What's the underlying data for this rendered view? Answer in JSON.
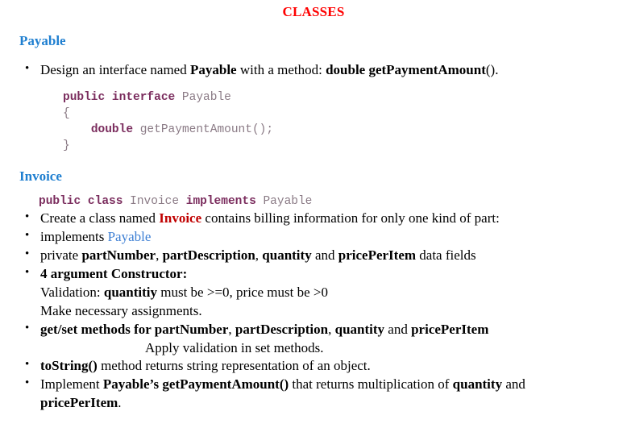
{
  "document": {
    "title": "CLASSES",
    "title_color": "#ff0000",
    "heading_color": "#1f7fd0",
    "link_color": "#3d7fd4",
    "accent_red": "#c00000",
    "code_keyword_color": "#7b2d5e",
    "code_identifier_color": "#8a7a85",
    "background_color": "#ffffff"
  },
  "payable_section": {
    "heading": "Payable",
    "bullet": {
      "text_1": "Design an interface named ",
      "bold_1": "Payable",
      "text_2": " with a method: ",
      "bold_2": "double getPaymentAmount",
      "text_3": "()."
    },
    "code": {
      "line1_kw1": "public interface",
      "line1_name": " Payable",
      "line2": "{",
      "line3_kw": "double",
      "line3_rest": " getPaymentAmount();",
      "line4": "}"
    }
  },
  "invoice_section": {
    "heading": "Invoice",
    "code": {
      "kw1": "public class",
      "name1": " Invoice ",
      "kw2": "implements",
      "name2": " Payable"
    },
    "bullets": {
      "b1_text1": "Create a class named ",
      "b1_red": "Invoice",
      "b1_text2": " contains billing information for only one kind of part:",
      "b2_text1": "implements ",
      "b2_link": "Payable",
      "b3_text1": "private ",
      "b3_bold1": "partNumber",
      "b3_text2": ", ",
      "b3_bold2": "partDescription",
      "b3_text3": ", ",
      "b3_bold3": "quantity",
      "b3_text4": " and ",
      "b3_bold4": "pricePerItem",
      "b3_text5": " data fields",
      "b4_bold": "4 argument Constructor:",
      "b4_sub1_text1": "Validation: ",
      "b4_sub1_bold": "quantitiy",
      "b4_sub1_text2": " must be >=0, price must be >0",
      "b4_sub2": "Make necessary assignments.",
      "b5_bold1": "get/set methods for partNumber",
      "b5_text1": ", ",
      "b5_bold2": "partDescription",
      "b5_text2": ", ",
      "b5_bold3": "quantity",
      "b5_text3": " and ",
      "b5_bold4": "pricePerItem",
      "b5_sub": "Apply validation in set methods.",
      "b6_bold": "toString()",
      "b6_text": " method returns string representation of an object.",
      "b7_text1": "Implement ",
      "b7_bold1": "Payable’s getPaymentAmount()",
      "b7_text2": " that returns multiplication of ",
      "b7_bold2": "quantity",
      "b7_text3": " and ",
      "b7_bold3": "pricePerItem",
      "b7_text4": "."
    }
  }
}
